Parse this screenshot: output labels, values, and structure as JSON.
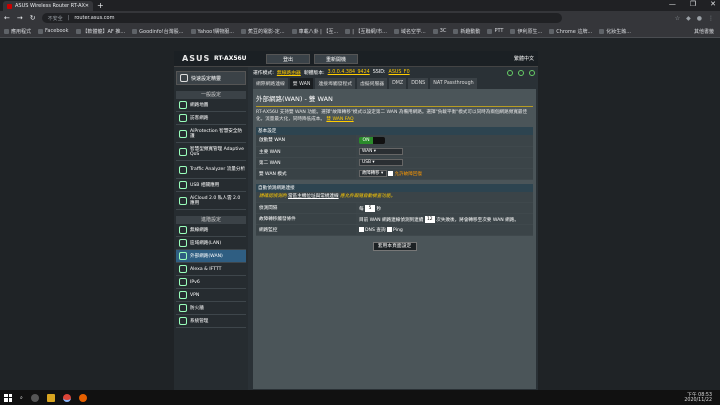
{
  "browser": {
    "tab_title": "ASUS Wireless Router RT-AX5...",
    "new_tab": "+",
    "url_security": "不安全",
    "url": "router.asus.com",
    "window": [
      "—",
      "❐",
      "✕"
    ],
    "bookmarks": [
      "應用程式",
      "Facebook",
      "【軟體龍】AF 推...",
      "Goodinfo!台灣股...",
      "Yahoo!購物服...",
      "蕉豆的電影-定...",
      "車載八卦 | 【互...",
      "| 【互聯網/市...",
      "域名空学...",
      "3C",
      "新趣動動",
      "PTT",
      "伊利原生...",
      "Chrome 這牌...",
      "化妝生蝕..."
    ],
    "bookmark_right": "其他書籤"
  },
  "router": {
    "logo": "ASUS",
    "model": "RT-AX56U",
    "logout": "登出",
    "reboot": "重新開機",
    "language": "繁體中文",
    "quick_setup": "快速設定精靈",
    "general_title": "一般設定",
    "general_items": [
      {
        "l": "網路地圖"
      },
      {
        "l": "訪客網路"
      },
      {
        "l": "AiProtection 智慧安全防護"
      },
      {
        "l": "智慧型頻寬管理 Adaptive QoS"
      },
      {
        "l": "Traffic Analyzer 流量分析"
      },
      {
        "l": "USB 相關應用"
      },
      {
        "l": "AiCloud 2.0 私人雲 2.0 應用"
      }
    ],
    "advanced_title": "進階設定",
    "advanced_items": [
      {
        "l": "無線網路"
      },
      {
        "l": "區域網路(LAN)"
      },
      {
        "l": "外部網路(WAN)"
      },
      {
        "l": "Alexa & IFTTT"
      },
      {
        "l": "IPv6"
      },
      {
        "l": "VPN"
      },
      {
        "l": "防火牆"
      },
      {
        "l": "系統管理"
      }
    ],
    "info": {
      "mode_label": "運作模式:",
      "mode": "無線路由器",
      "fw_label": "韌體版本:",
      "fw": "3.0.0.4.384_9424",
      "ssid_label": "SSID:",
      "ssid": "ASUS_F0"
    },
    "tabs": [
      "網際網路連線",
      "雙 WAN",
      "連接埠觸發程式",
      "虛擬伺服器",
      "DMZ",
      "DDNS",
      "NAT Passthrough"
    ],
    "page_title": "外部網路(WAN) - 雙 WAN",
    "desc": "RT-AX56U 支持雙 WAN 功能。選擇\"故障轉移\"模式以設定第二 WAN 為備用網路。選擇\"負載平衡\"模式可以同時為兩個網路頻寬最佳化，流量最大化，同時降低成本。",
    "faq": "雙 WAN FAQ",
    "basic_header": "基本設定",
    "basic_rows": [
      {
        "k": "啟動雙 WAN"
      },
      {
        "k": "主要 WAN",
        "v": "WAN"
      },
      {
        "k": "第二 WAN",
        "v": "USB"
      },
      {
        "k": "雙 WAN 模式",
        "v": "故障轉移",
        "extra": "允許故障回復"
      }
    ],
    "toggle_on": "ON",
    "auto_header": "自動偵測網路連接",
    "auto_note": "請確認偵測的 ",
    "auto_note_link": "當區主機位址與常規連線",
    "auto_note_tail": " 應允許跟隨自動檢查功能。",
    "auto_rows": [
      {
        "k": "偵測間隔",
        "pre": "每",
        "num": "5",
        "post": "秒"
      },
      {
        "k": "故障轉移觸發條件",
        "pre": "目前 WAN 網路連線偵測到連續",
        "num": "12",
        "post": "次失敗後，將會轉移至次要 WAN 網路。"
      },
      {
        "k": "網路監控",
        "dns": "DNS 查詢",
        "ping": "Ping"
      }
    ],
    "apply": "套用本頁面設定"
  },
  "taskbar": {
    "time": "下午 08:53",
    "date": "2020/11/22"
  }
}
